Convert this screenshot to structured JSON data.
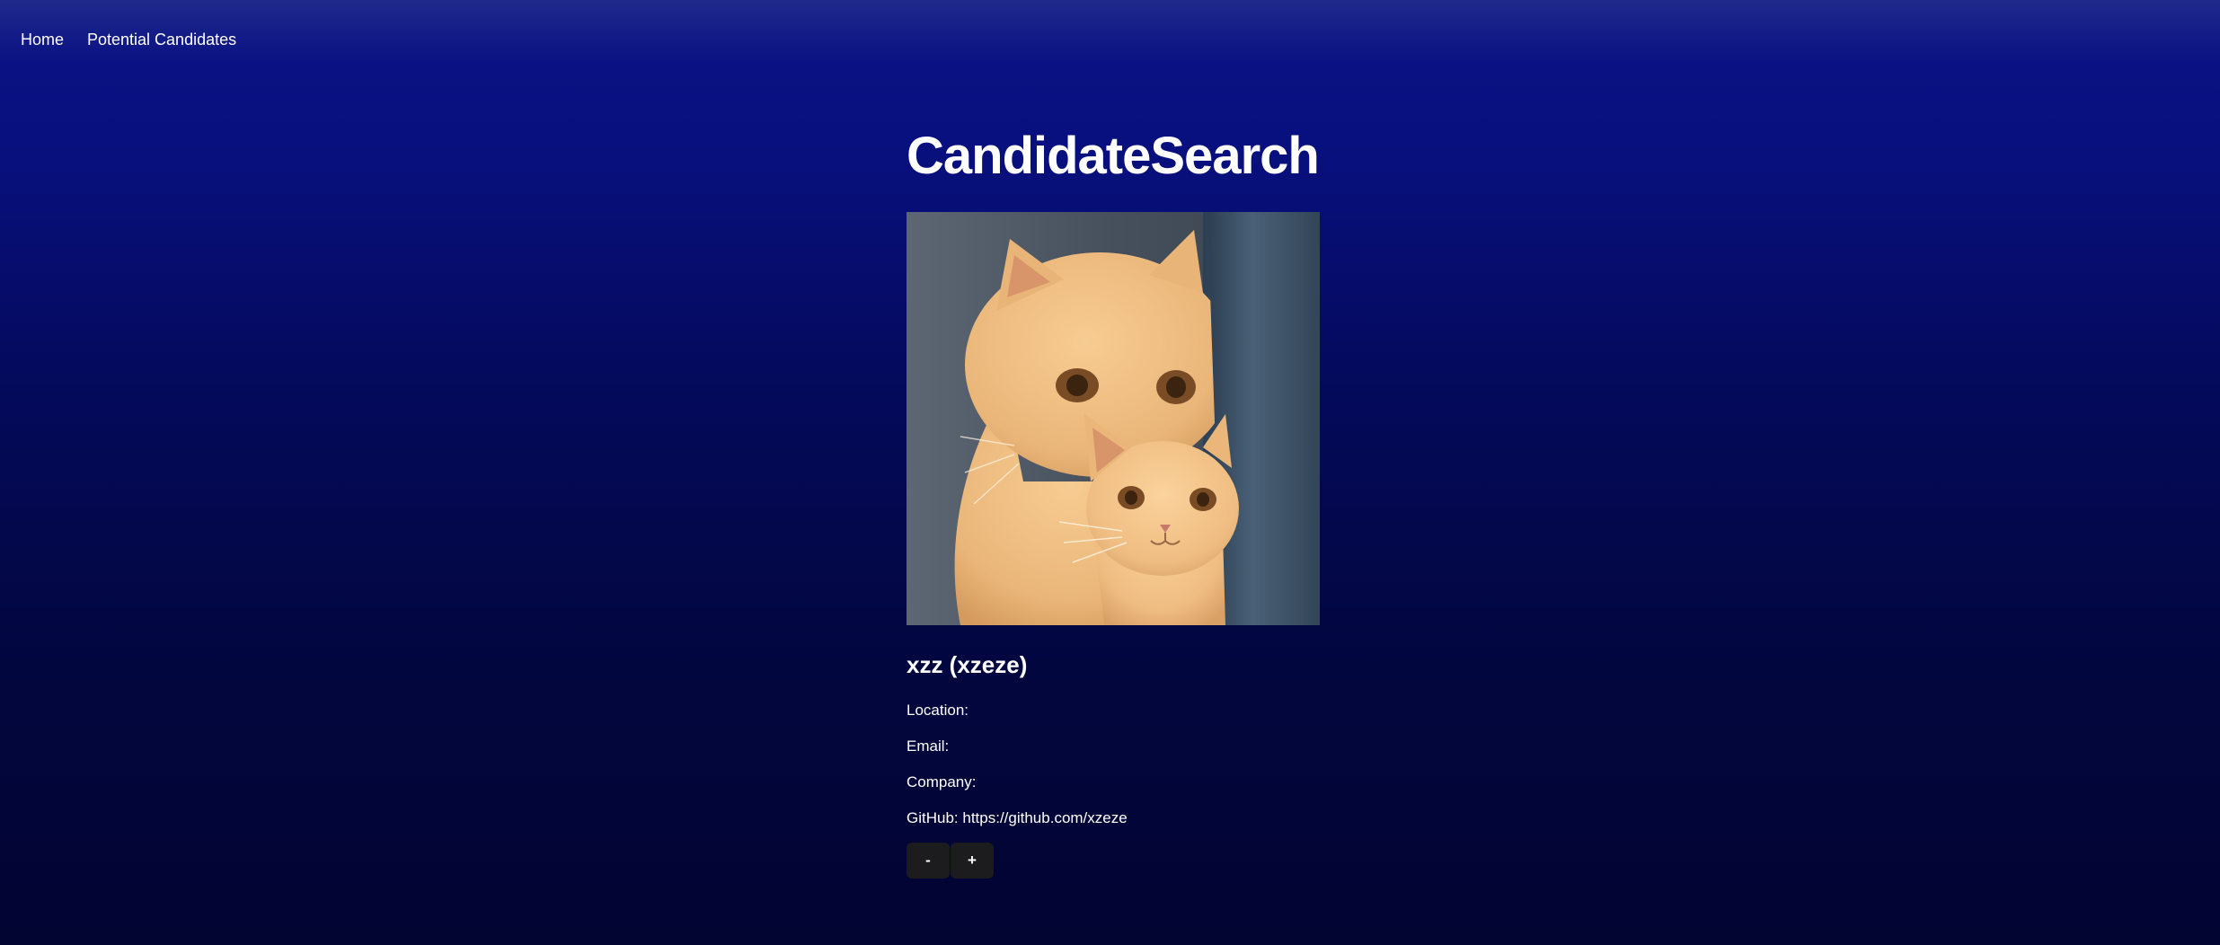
{
  "nav": {
    "items": [
      {
        "label": "Home"
      },
      {
        "label": "Potential Candidates"
      }
    ]
  },
  "page": {
    "title": "CandidateSearch"
  },
  "candidate": {
    "image_alt": "candidate avatar",
    "name_line": "xzz (xzeze)",
    "location_label": "Location:",
    "location_value": "",
    "email_label": "Email:",
    "email_value": "",
    "company_label": "Company:",
    "company_value": "",
    "github_label": "GitHub:",
    "github_value": "https://github.com/xzeze"
  },
  "actions": {
    "reject_label": "-",
    "accept_label": "+"
  },
  "colors": {
    "background_top": "#1f2a8c",
    "background_bottom": "#020432",
    "button_bg": "#1c1c1f",
    "text": "#ffffff"
  }
}
